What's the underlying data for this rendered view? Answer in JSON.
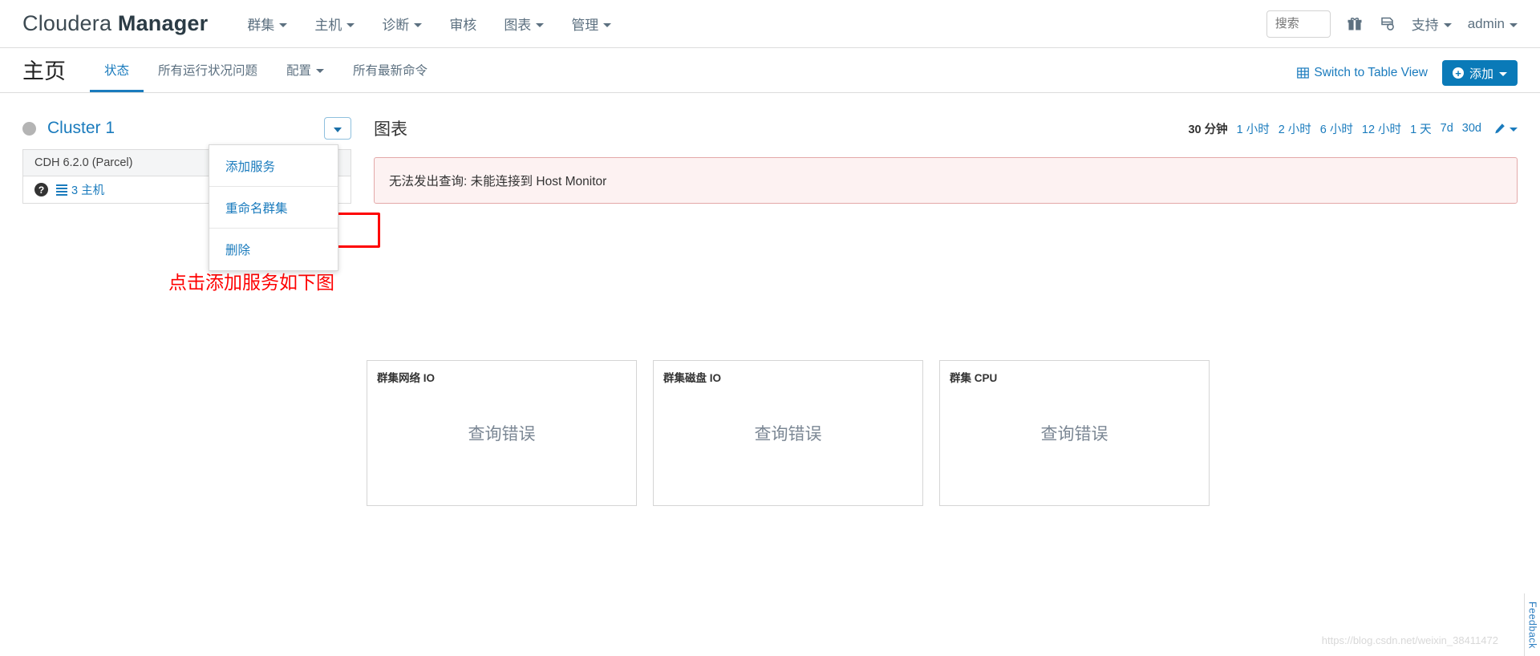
{
  "header": {
    "brand_light": "Cloudera",
    "brand_bold": "Manager",
    "menu": [
      {
        "label": "群集",
        "caret": true
      },
      {
        "label": "主机",
        "caret": true
      },
      {
        "label": "诊断",
        "caret": true
      },
      {
        "label": "审核",
        "caret": false
      },
      {
        "label": "图表",
        "caret": true
      },
      {
        "label": "管理",
        "caret": true
      }
    ],
    "search_placeholder": "搜索",
    "gift_icon": "gift-icon",
    "diagram_icon": "parcel-diagram-icon",
    "support_label": "支持",
    "user_label": "admin"
  },
  "subnav": {
    "page_title": "主页",
    "tabs": [
      {
        "label": "状态",
        "active": true,
        "caret": false
      },
      {
        "label": "所有运行状况问题",
        "active": false,
        "caret": false
      },
      {
        "label": "配置",
        "active": false,
        "caret": true
      },
      {
        "label": "所有最新命令",
        "active": false,
        "caret": false
      }
    ],
    "switch_view_label": "Switch to Table View",
    "add_button_label": "添加"
  },
  "cluster": {
    "name": "Cluster 1",
    "status": "gray",
    "version_row": "CDH 6.2.0 (Parcel)",
    "hosts_label": "3 主机",
    "menu_items": [
      "添加服务",
      "重命名群集",
      "删除"
    ],
    "annotation": "点击添加服务如下图"
  },
  "charts": {
    "title": "图表",
    "time_ranges": [
      {
        "label": "30 分钟",
        "selected": true
      },
      {
        "label": "1 小时",
        "selected": false
      },
      {
        "label": "2 小时",
        "selected": false
      },
      {
        "label": "6 小时",
        "selected": false
      },
      {
        "label": "12 小时",
        "selected": false
      },
      {
        "label": "1 天",
        "selected": false
      },
      {
        "label": "7d",
        "selected": false
      },
      {
        "label": "30d",
        "selected": false
      }
    ],
    "error_message": "无法发出查询: 未能连接到 Host Monitor",
    "cards": [
      {
        "title": "群集网络 IO",
        "message": "查询错误"
      },
      {
        "title": "群集磁盘 IO",
        "message": "查询错误"
      },
      {
        "title": "群集 CPU",
        "message": "查询错误"
      }
    ]
  },
  "footer": {
    "watermark": "https://blog.csdn.net/weixin_38411472",
    "feedback_label": "Feedback"
  },
  "colors": {
    "accent_blue": "#1a7bbd",
    "button_blue": "#0a7ab8",
    "error_red": "#fe0000",
    "alert_bg": "#fdf2f2"
  }
}
